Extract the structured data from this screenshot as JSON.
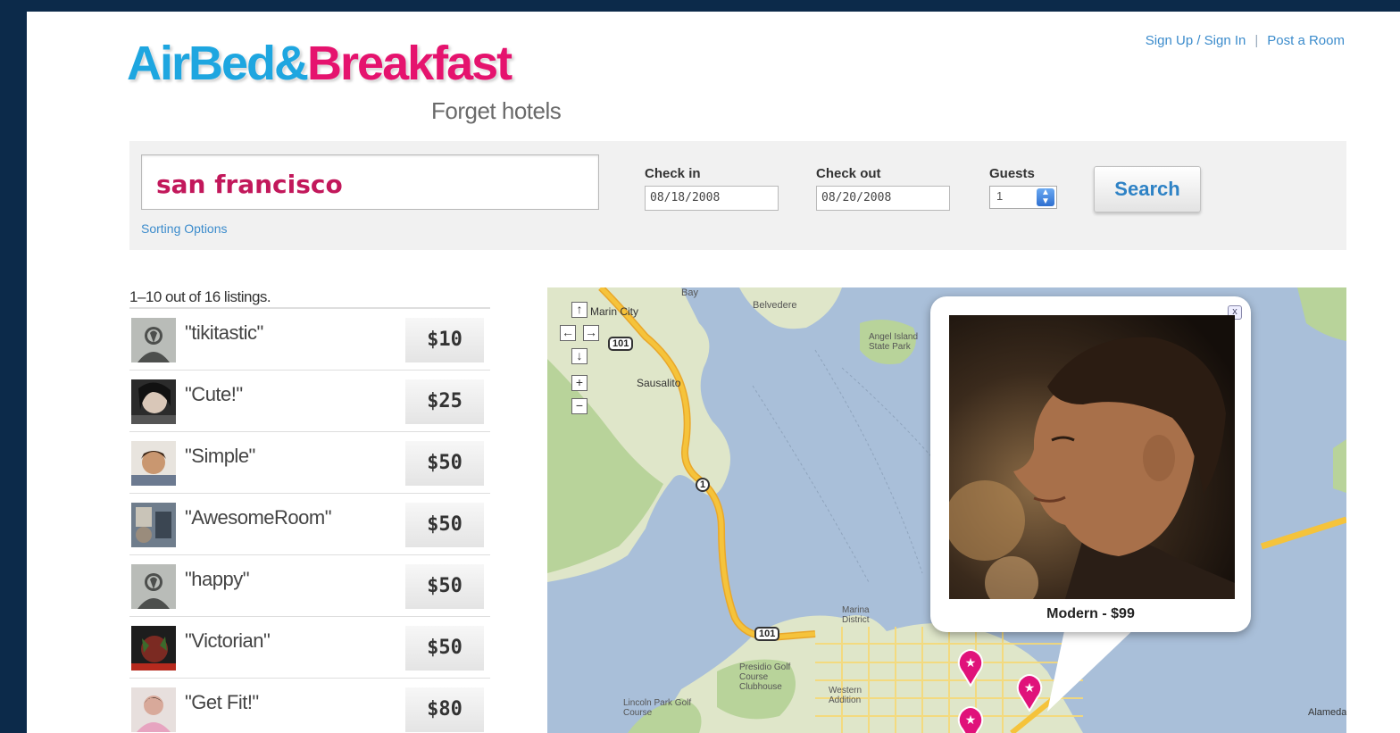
{
  "header": {
    "logo": {
      "part1": "AirBed",
      "amp": "&",
      "part2": "Breakfast"
    },
    "tagline": "Forget hotels",
    "links": [
      "Sign Up / Sign In",
      "Post a Room"
    ]
  },
  "search": {
    "where_value": "san francisco",
    "sorting_label": "Sorting Options",
    "checkin_label": "Check in",
    "checkin_value": "08/18/2008",
    "checkout_label": "Check out",
    "checkout_value": "08/20/2008",
    "guests_label": "Guests",
    "guests_value": "1",
    "search_button": "Search"
  },
  "listings": {
    "count_text": "1–10 out of 16 listings.",
    "items": [
      {
        "title": "\"tikitastic\"",
        "price": "$10",
        "avatar": "default-silhouette-icon"
      },
      {
        "title": "\"Cute!\"",
        "price": "$25",
        "avatar": "user-photo"
      },
      {
        "title": "\"Simple\"",
        "price": "$50",
        "avatar": "user-photo"
      },
      {
        "title": "\"AwesomeRoom\"",
        "price": "$50",
        "avatar": "user-photo"
      },
      {
        "title": "\"happy\"",
        "price": "$50",
        "avatar": "default-silhouette-icon"
      },
      {
        "title": "\"Victorian\"",
        "price": "$50",
        "avatar": "user-photo"
      },
      {
        "title": "\"Get Fit!\"",
        "price": "$80",
        "avatar": "user-photo"
      }
    ]
  },
  "map": {
    "labels": {
      "marin_city": "Marin City",
      "belvedere": "Belvedere",
      "sausalito": "Sausalito",
      "angel_island": "Angel Island State Park",
      "marina": "Marina District",
      "presidio": "Presidio Golf Course Clubhouse",
      "lincoln": "Lincoln Park Golf Course",
      "western": "Western Addition",
      "alameda": "Alameda",
      "bay": "Bay"
    },
    "highways": [
      "101",
      "1",
      "101"
    ],
    "popup": {
      "caption": "Modern - $99",
      "close": "x"
    },
    "colors": {
      "water": "#a9bfd9",
      "land": "#dfe6c9",
      "park": "#b8d39a",
      "highway": "#f5c33b",
      "pin": "#e0127a"
    }
  }
}
